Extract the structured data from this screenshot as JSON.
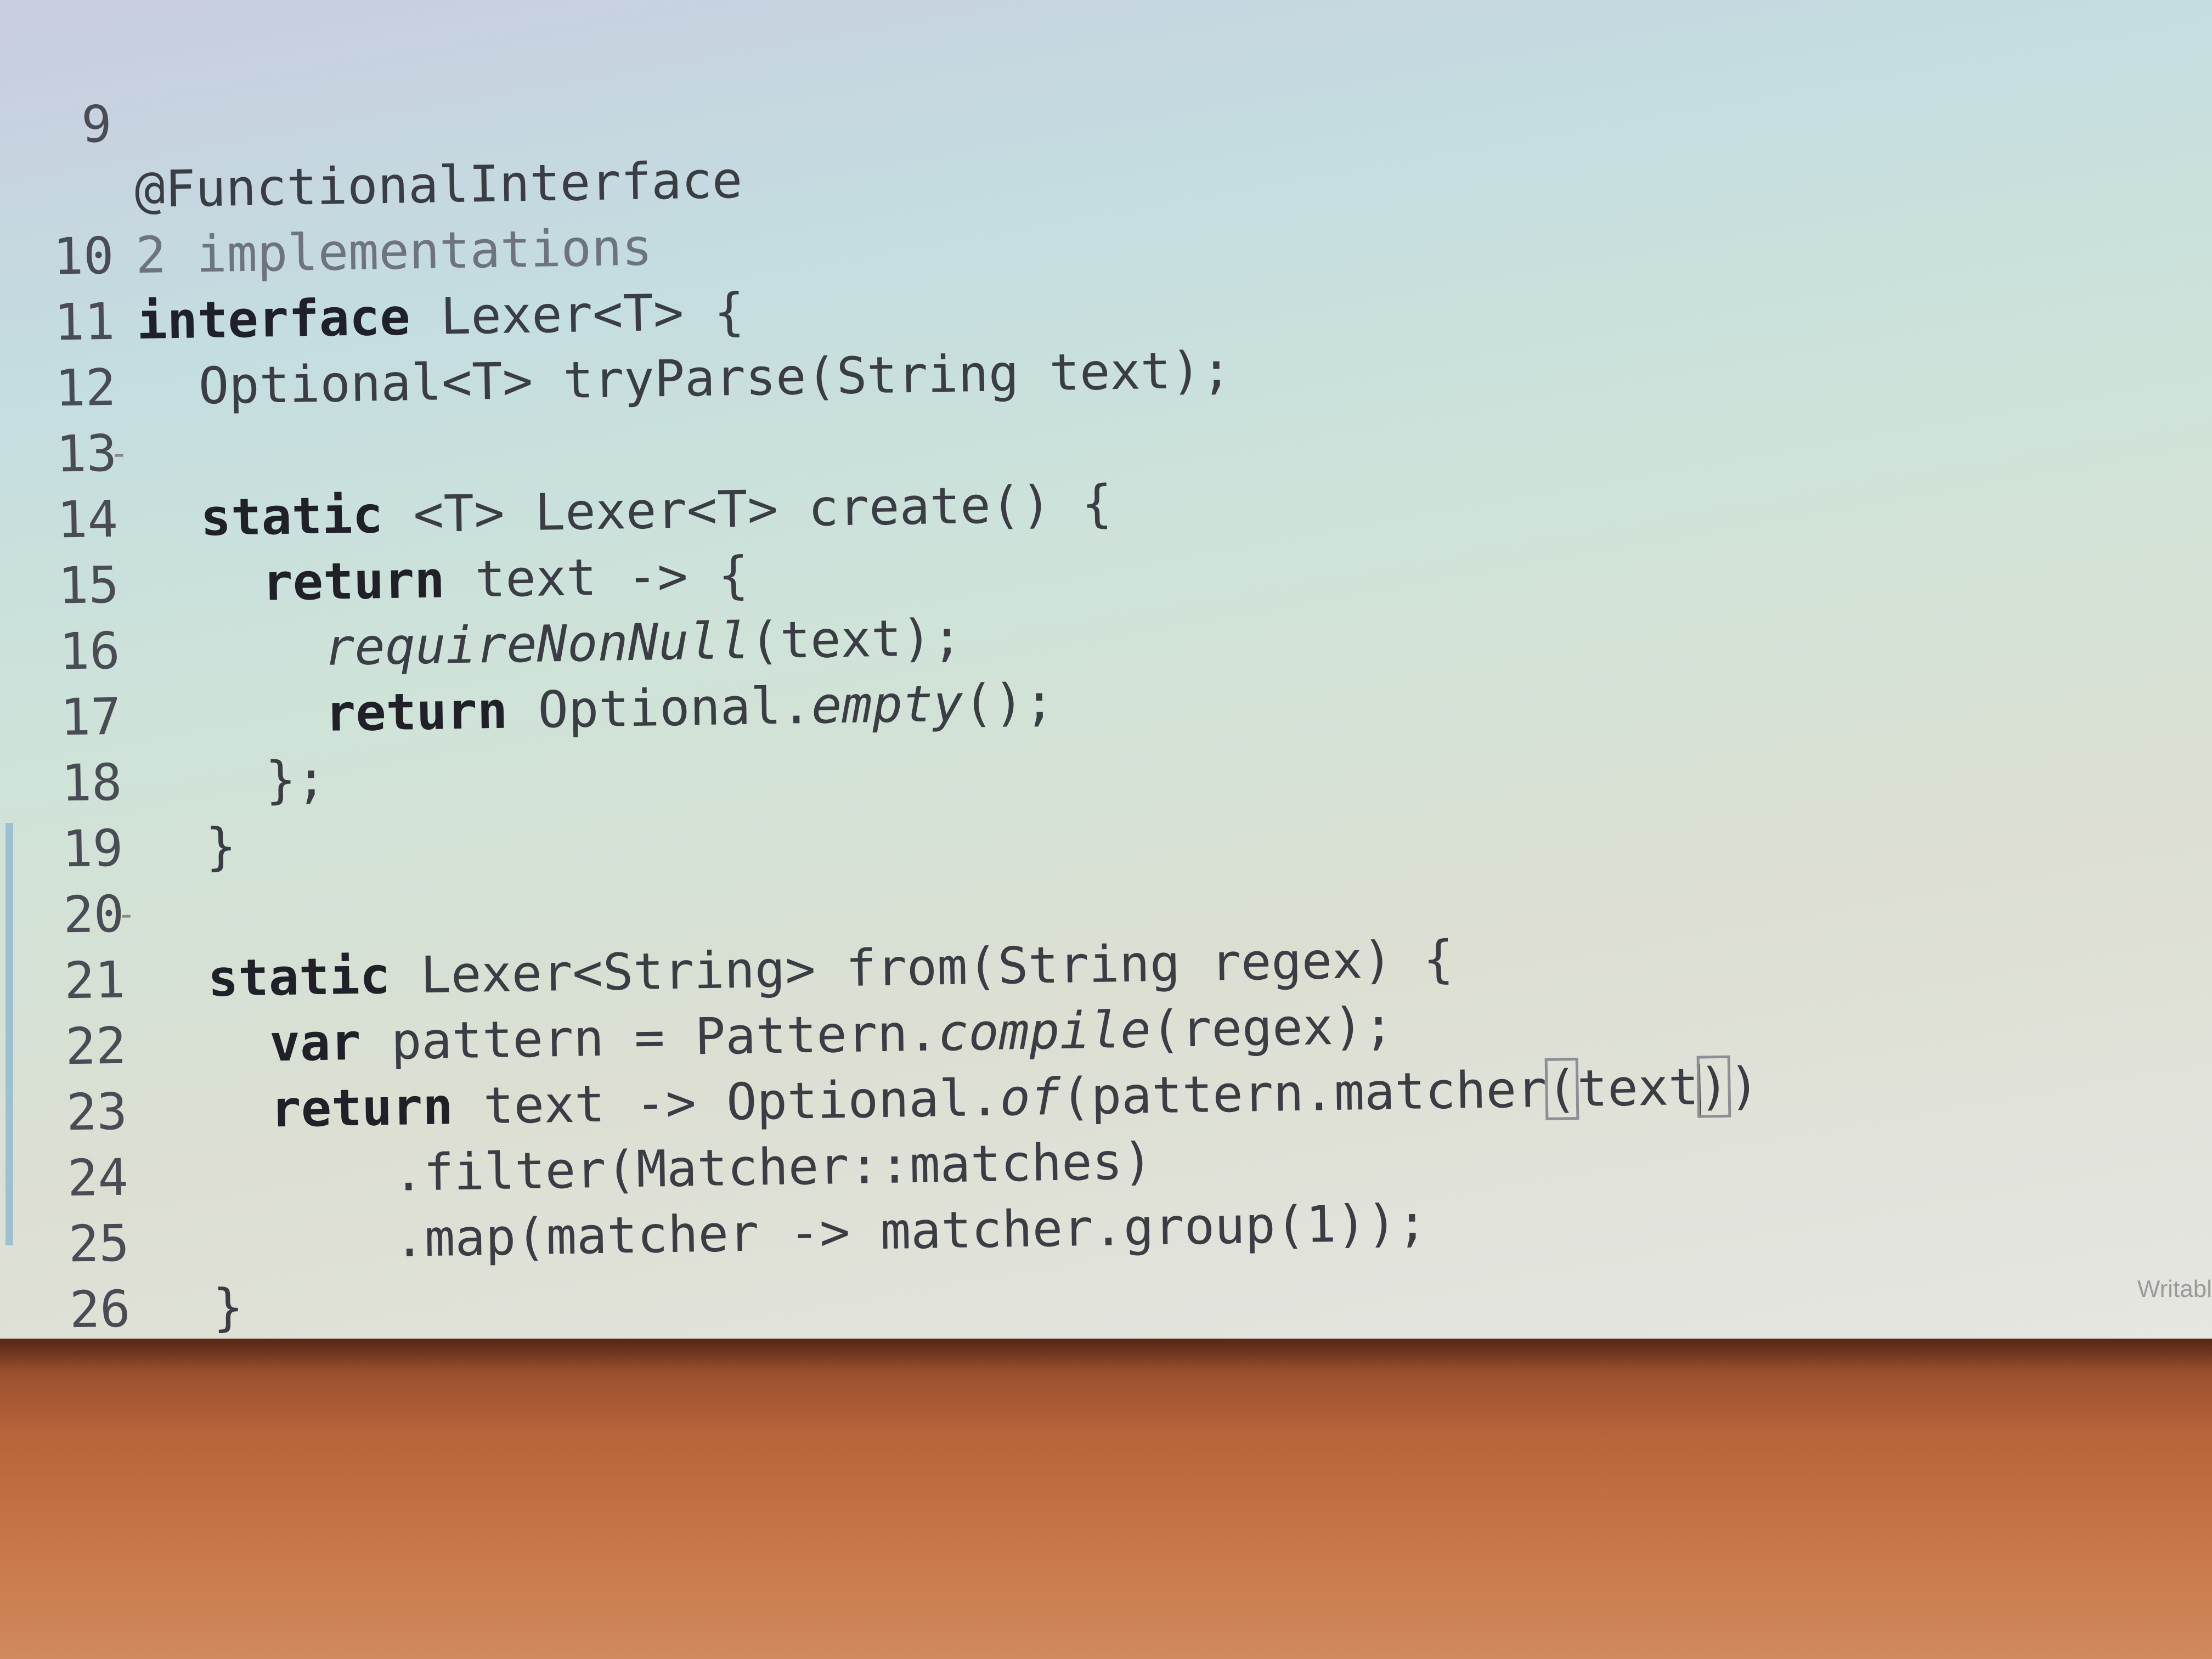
{
  "editor": {
    "lines": [
      {
        "num": "9",
        "text": "@FunctionalInterface"
      },
      {
        "num": "",
        "text": "2 implementations"
      },
      {
        "num": "10",
        "text": "interface Lexer<T> {"
      },
      {
        "num": "11",
        "text": "  Optional<T> tryParse(String text);"
      },
      {
        "num": "12",
        "text": ""
      },
      {
        "num": "13",
        "text": "  static <T> Lexer<T> create() {"
      },
      {
        "num": "14",
        "text": "    return text -> {"
      },
      {
        "num": "15",
        "text": "      requireNonNull(text);"
      },
      {
        "num": "16",
        "text": "      return Optional.empty();"
      },
      {
        "num": "17",
        "text": "    };"
      },
      {
        "num": "18",
        "text": "  }"
      },
      {
        "num": "19",
        "text": ""
      },
      {
        "num": "20",
        "text": "  static Lexer<String> from(String regex) {"
      },
      {
        "num": "21",
        "text": "    var pattern = Pattern.compile(regex);"
      },
      {
        "num": "22",
        "text": "    return text -> Optional.of(pattern.matcher(text))"
      },
      {
        "num": "23",
        "text": "        .filter(Matcher::matches)"
      },
      {
        "num": "24",
        "text": "        .map(matcher -> matcher.group(1));"
      },
      {
        "num": "25",
        "text": "  }"
      },
      {
        "num": "26",
        "text": "}"
      }
    ]
  },
  "status_bar": {
    "writable": "Writabl"
  }
}
